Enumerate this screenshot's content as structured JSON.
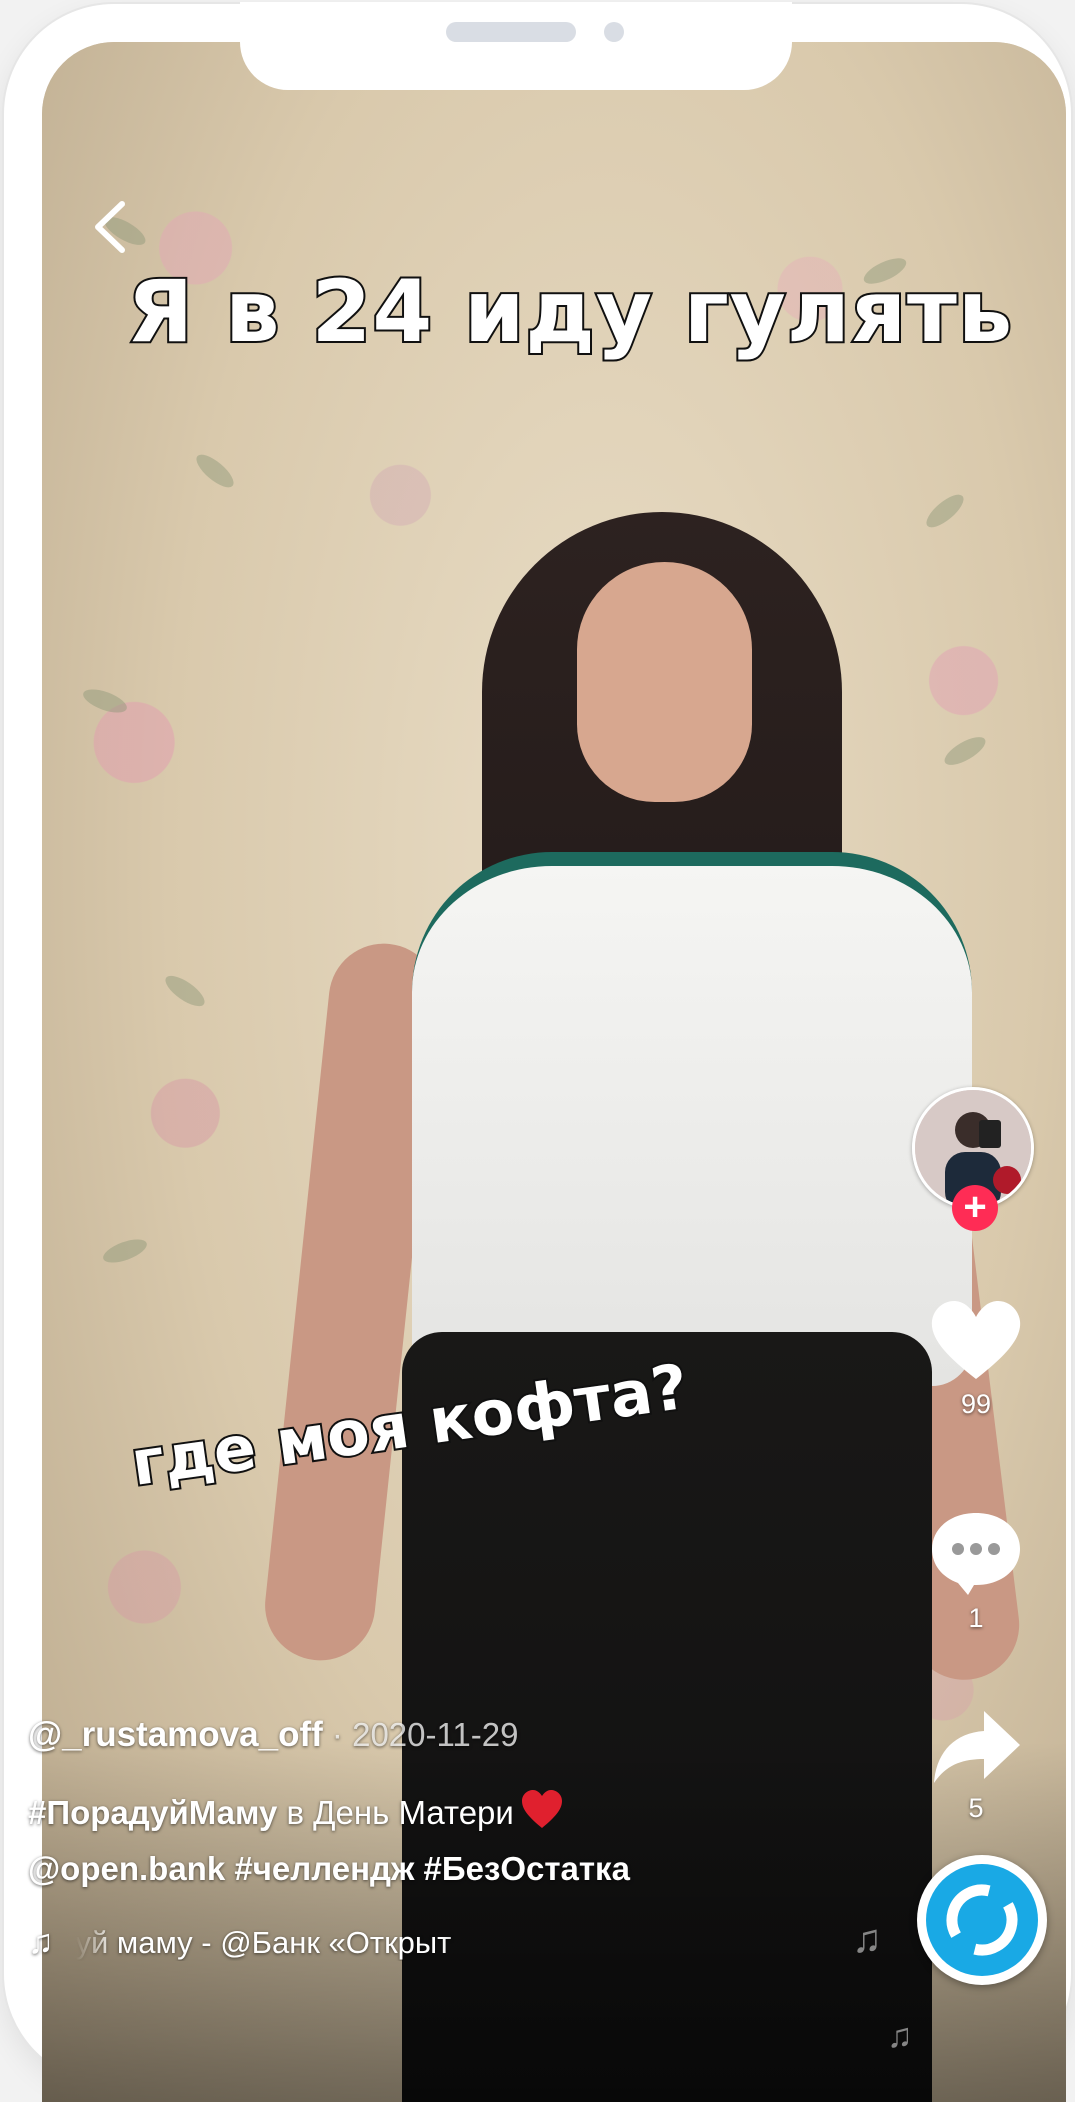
{
  "video": {
    "caption_top": "Я в 24 иду гулять",
    "caption_middle": "где моя кофта?"
  },
  "author": {
    "handle": "@_rustamova_off",
    "separator": " · ",
    "date": "2020-11-29"
  },
  "description": {
    "hashtag_1": "#ПорадуйМаму",
    "text_1": " в День Матери",
    "emoji": "heart-emoji",
    "mention": "@open.bank",
    "hashtag_2": " #челлендж",
    "hashtag_3": " #БезОстатка"
  },
  "music": {
    "note_symbol": "♫",
    "track": "уй маму - @Банк «Открыт"
  },
  "actions": {
    "likes": "99",
    "comments": "1",
    "shares": "5"
  },
  "icons": {
    "back": "chevron-left-icon",
    "follow": "plus-icon",
    "like": "heart-icon",
    "comment": "comment-bubble-icon",
    "share": "share-arrow-icon",
    "disc": "rotating-disc-icon"
  },
  "colors": {
    "accent": "#ff2c55",
    "disc_ring": "#19a9e5",
    "white": "#ffffff"
  }
}
